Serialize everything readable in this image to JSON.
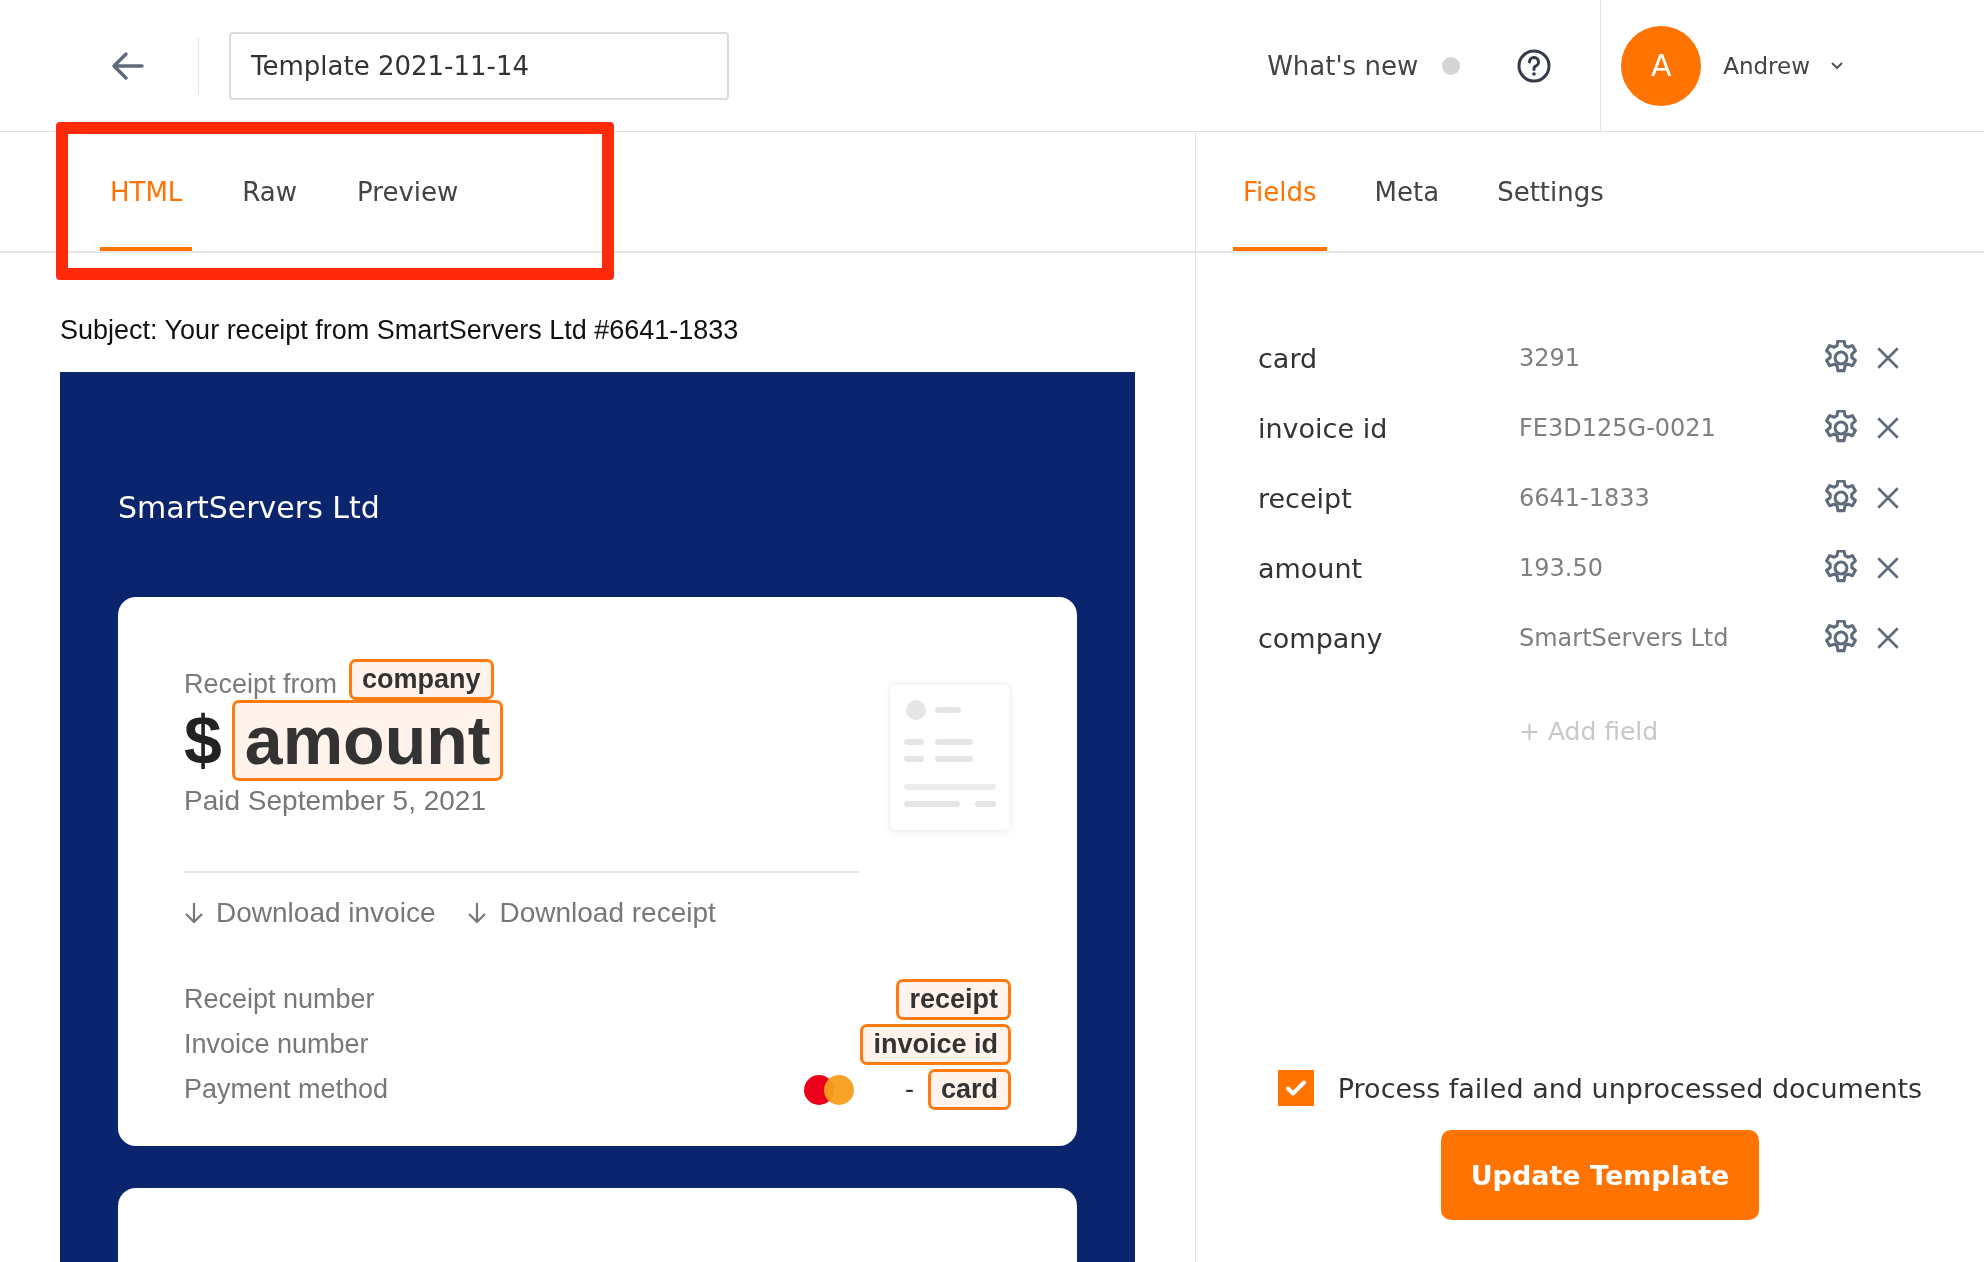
{
  "header": {
    "title_field": {
      "value": "Template 2021-11-14"
    },
    "whats_new": "What's new",
    "user": {
      "initial": "A",
      "name": "Andrew"
    }
  },
  "editor_tabs": [
    {
      "label": "HTML",
      "selected": true
    },
    {
      "label": "Raw",
      "selected": false
    },
    {
      "label": "Preview",
      "selected": false
    }
  ],
  "subject": "Subject: Your receipt from SmartServers Ltd #6641-1833",
  "email": {
    "company_name": "SmartServers Ltd",
    "receipt_from": "Receipt from",
    "company_token": "company",
    "currency": "$",
    "amount_token": "amount",
    "paid": "Paid September 5, 2021",
    "links": [
      "Download invoice",
      "Download receipt"
    ],
    "details": [
      {
        "kind": "plain",
        "label": "Receipt number",
        "token": "receipt"
      },
      {
        "kind": "plain",
        "label": "Invoice number",
        "token": "invoice id"
      },
      {
        "kind": "card",
        "label": "Payment method",
        "prefix": "-",
        "token": "card"
      }
    ]
  },
  "panel_tabs": [
    {
      "label": "Fields",
      "selected": true
    },
    {
      "label": "Meta",
      "selected": false
    },
    {
      "label": "Settings",
      "selected": false
    }
  ],
  "fields": [
    {
      "name": "card",
      "value": "3291"
    },
    {
      "name": "invoice id",
      "value": "FE3D125G-0021"
    },
    {
      "name": "receipt",
      "value": "6641-1833"
    },
    {
      "name": "amount",
      "value": "193.50"
    },
    {
      "name": "company",
      "value": "SmartServers Ltd"
    }
  ],
  "add_field": "+ Add field",
  "process_option": {
    "label": "Process failed and unprocessed documents",
    "checked": true
  },
  "update_button": "Update Template"
}
